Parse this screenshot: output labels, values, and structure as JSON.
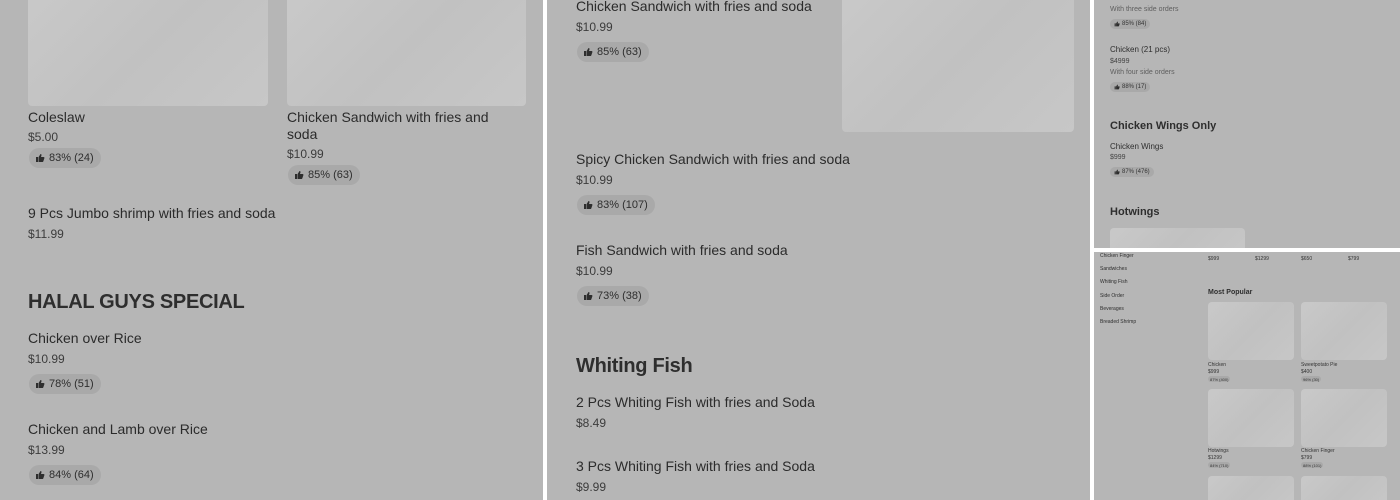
{
  "panel1": {
    "items_top": [
      {
        "name": "Coleslaw",
        "price": "$5.00",
        "rating": "83% (24)"
      },
      {
        "name": "Chicken Sandwich with fries and soda",
        "price": "$10.99",
        "rating": "85% (63)"
      }
    ],
    "shrimp": {
      "name": "9 Pcs Jumbo shrimp with fries and soda",
      "price": "$11.99"
    },
    "section": "HALAL GUYS SPECIAL",
    "halal_items": [
      {
        "name": "Chicken over Rice",
        "price": "$10.99",
        "rating": "78% (51)"
      },
      {
        "name": "Chicken and Lamb over Rice",
        "price": "$13.99",
        "rating": "84% (64)"
      }
    ]
  },
  "panel2": {
    "items": [
      {
        "name": "Chicken Sandwich with fries and soda",
        "price": "$10.99",
        "rating": "85% (63)"
      },
      {
        "name": "Spicy Chicken Sandwich with fries and soda",
        "price": "$10.99",
        "rating": "83% (107)"
      },
      {
        "name": "Fish Sandwich with fries and soda",
        "price": "$10.99",
        "rating": "73% (38)"
      }
    ],
    "section": "Whiting Fish",
    "fish_items": [
      {
        "name": "2 Pcs Whiting Fish with fries and Soda",
        "price": "$8.49"
      },
      {
        "name": "3 Pcs Whiting Fish with fries and Soda",
        "price": "$9.99"
      }
    ]
  },
  "panel3": {
    "partial": {
      "desc": "With three side orders",
      "rating": "85% (84)"
    },
    "chicken21": {
      "name": "Chicken (21 pcs)",
      "price": "$4999",
      "desc": "With four side orders",
      "rating": "88% (17)"
    },
    "wings_section": "Chicken Wings Only",
    "wings": {
      "name": "Chicken Wings",
      "price": "$999",
      "rating": "87% (476)"
    },
    "hotwings_section": "Hotwings"
  },
  "panel4": {
    "nav": [
      "Chicken Finger",
      "Sandwiches",
      "Whiting Fish",
      "Side Order",
      "Beverages",
      "Breaded Shrimp"
    ],
    "top_prices": [
      "$999",
      "$1299",
      "$650",
      "$799"
    ],
    "section": "Most Popular",
    "cards": [
      {
        "name": "Chicken",
        "price": "$999",
        "rating": "87% (400)"
      },
      {
        "name": "Sweetpotato Pie",
        "price": "$400",
        "rating": "96% (30)"
      },
      {
        "name": "Hotwings",
        "price": "$1299",
        "rating": "84% (710)"
      },
      {
        "name": "Chicken Finger",
        "price": "$799",
        "rating": "88% (101)"
      }
    ]
  }
}
